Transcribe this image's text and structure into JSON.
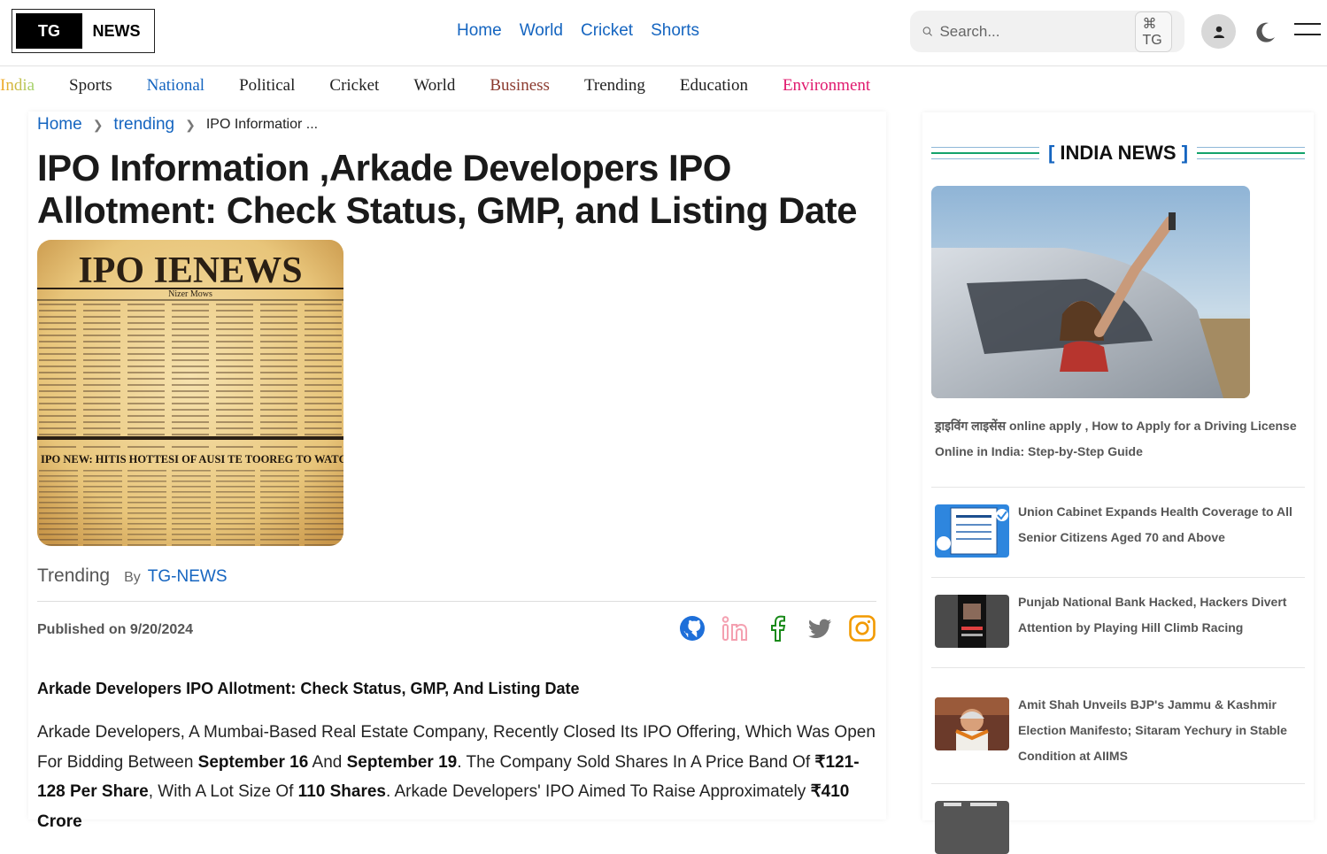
{
  "logo": {
    "left": "TG",
    "right": "NEWS"
  },
  "topnav": [
    "Home",
    "World",
    "Cricket",
    "Shorts"
  ],
  "search": {
    "placeholder": "Search...",
    "shortcut": "⌘ TG"
  },
  "categories": [
    {
      "label": "India",
      "color": "#f0c020"
    },
    {
      "label": "Sports",
      "color": "#222222"
    },
    {
      "label": "National",
      "color": "#1565c0"
    },
    {
      "label": "Political",
      "color": "#222222"
    },
    {
      "label": "Cricket",
      "color": "#222222"
    },
    {
      "label": "World",
      "color": "#222222"
    },
    {
      "label": "Business",
      "color": "#8b3a2e"
    },
    {
      "label": "Trending",
      "color": "#222222"
    },
    {
      "label": "Education",
      "color": "#222222"
    },
    {
      "label": "Environment",
      "color": "#e0196e"
    }
  ],
  "breadcrumb": {
    "home": "Home",
    "section": "trending",
    "current": "IPO Informatior ..."
  },
  "article": {
    "title": "IPO Information ,Arkade Developers IPO Allotment: Check Status, GMP, and Listing Date",
    "hero_headline": "IPO IENEWS",
    "hero_sub": "IPO NEW: HITIS HOTTESI OF AUSI TE TOOREG TO WATCH.",
    "category": "Trending",
    "by": "By",
    "author": "TG-NEWS",
    "published": "Published on 9/20/2024",
    "subhead": "Arkade Developers IPO Allotment: Check Status, GMP, And Listing Date",
    "body": {
      "p1": "Arkade Developers, A Mumbai-Based Real Estate Company, Recently Closed Its IPO Offering, Which Was Open For Bidding Between ",
      "b1": "September 16",
      "p2": " And ",
      "b2": "September 19",
      "p3": ". The Company Sold Shares In A Price Band Of ",
      "b3": "₹121-128 Per Share",
      "p4": ", With A Lot Size Of ",
      "b4": "110 Shares",
      "p5": ". Arkade Developers' IPO Aimed To Raise Approximately ",
      "b5": "₹410 Crore"
    }
  },
  "social_icons": [
    "github-icon",
    "linkedin-icon",
    "facebook-icon",
    "twitter-icon",
    "instagram-icon"
  ],
  "sidebar": {
    "heading_open": "[",
    "heading": "INDIA NEWS",
    "heading_close": "]",
    "featured": "ड्राइविंग लाइसेंस online apply , How to Apply for a Driving License Online in India: Step-by-Step Guide",
    "items": [
      "Union Cabinet Expands Health Coverage to All Senior Citizens Aged 70 and Above",
      "Punjab National Bank Hacked, Hackers Divert Attention by Playing Hill Climb Racing",
      "Amit Shah Unveils BJP's Jammu & Kashmir Election Manifesto; Sitaram Yechury in Stable Condition at AIIMS"
    ]
  }
}
